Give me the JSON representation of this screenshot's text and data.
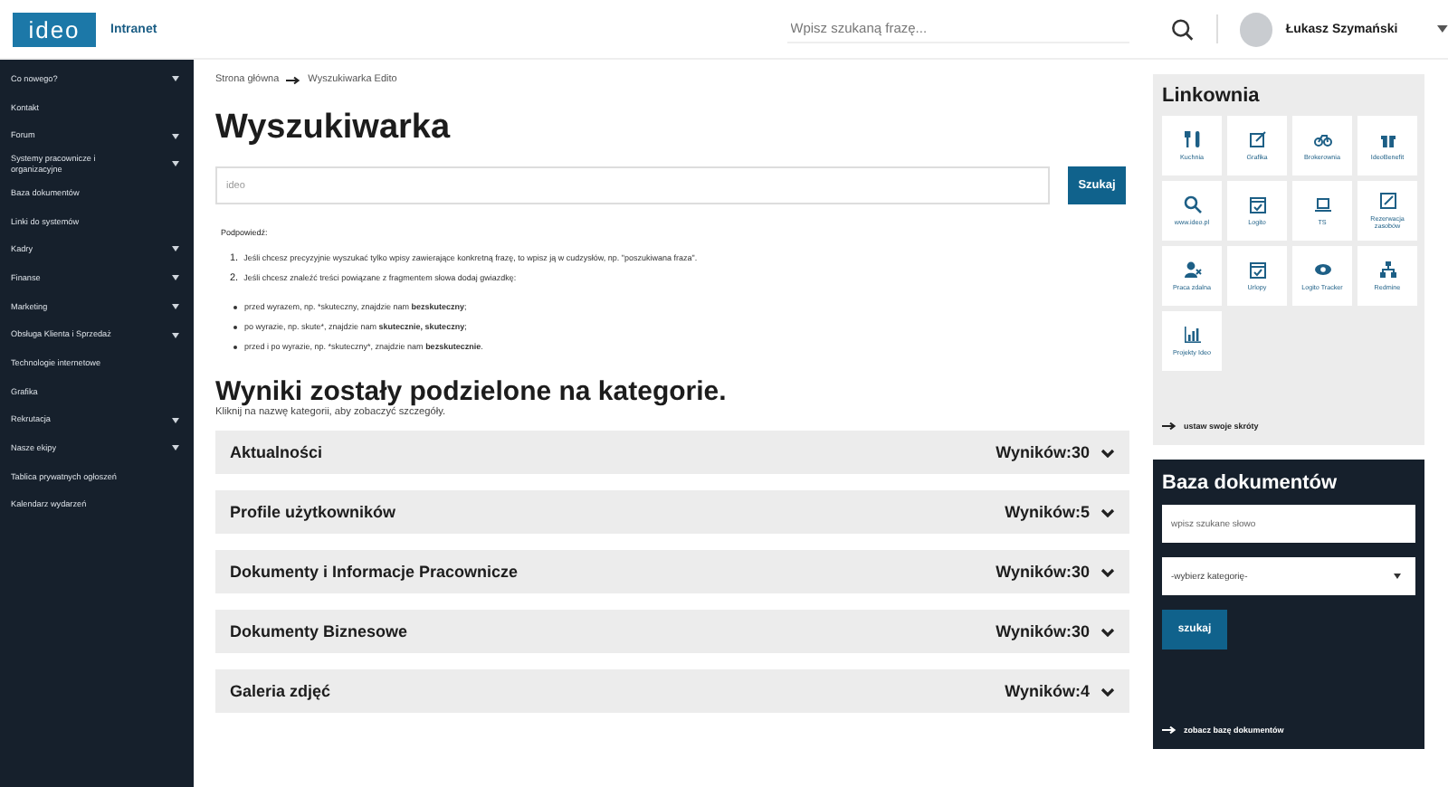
{
  "header": {
    "logo": "ideo",
    "app_name": "Intranet",
    "search": {
      "placeholder": "Wpisz szukaną frazę..."
    },
    "user": {
      "name": "Łukasz Szymański"
    }
  },
  "sidebar": {
    "items": [
      {
        "label": "Co nowego?",
        "expandable": true
      },
      {
        "label": "Kontakt",
        "expandable": false
      },
      {
        "label": "Forum",
        "expandable": true
      },
      {
        "label": "Systemy pracownicze i organizacyjne",
        "expandable": true
      },
      {
        "label": "Baza dokumentów",
        "expandable": false
      },
      {
        "label": "Linki do systemów",
        "expandable": false
      },
      {
        "label": "Kadry",
        "expandable": true
      },
      {
        "label": "Finanse",
        "expandable": true
      },
      {
        "label": "Marketing",
        "expandable": true
      },
      {
        "label": "Obsługa Klienta i Sprzedaż",
        "expandable": true
      },
      {
        "label": "Technologie internetowe",
        "expandable": false
      },
      {
        "label": "Grafika",
        "expandable": false
      },
      {
        "label": "Rekrutacja",
        "expandable": true
      },
      {
        "label": "Nasze ekipy",
        "expandable": true
      },
      {
        "label": "Tablica prywatnych ogłoszeń",
        "expandable": false
      },
      {
        "label": "Kalendarz wydarzeń",
        "expandable": false
      }
    ]
  },
  "breadcrumb": [
    "Strona główna",
    "Wyszukiwarka Edito"
  ],
  "title": "Wyszukiwarka",
  "search": {
    "value": "ideo",
    "button": "Szukaj"
  },
  "hints": {
    "heading": "Podpowiedź:",
    "numbered": [
      {
        "number": "1.",
        "text": "Jeśli chcesz precyzyjnie wyszukać tylko wpisy zawierające konkretną frazę, to wpisz ją w cudzysłów, np. \"poszukiwana fraza\"."
      },
      {
        "number": "2.",
        "text": "Jeśli chcesz znaleźć treści powiązane z fragmentem słowa dodaj gwiazdkę:"
      }
    ],
    "bullets": [
      {
        "text": "przed wyrazem, np. *skuteczny, znajdzie nam ",
        "bold": "bezskuteczny",
        "end": ";"
      },
      {
        "text": "po wyrazie, np. skute*, znajdzie nam ",
        "bold": "skutecznie, skuteczny",
        "end": ";"
      },
      {
        "text": "przed i po wyrazie, np. *skuteczny*, znajdzie nam ",
        "bold": "bezskutecznie",
        "end": "."
      }
    ]
  },
  "results": {
    "heading": "Wyniki zostały podzielone na kategorie.",
    "subheading": "Kliknij na nazwę kategorii, aby zobaczyć szczegóły.",
    "categories": [
      {
        "name": "Aktualności",
        "count": "Wyników:30",
        "expanded": false
      },
      {
        "name": "Profile użytkowników",
        "count": "Wyników:5",
        "expanded": false
      },
      {
        "name": "Dokumenty i Informacje Pracownicze",
        "count": "Wyników:30",
        "expanded": false
      },
      {
        "name": "Dokumenty Biznesowe",
        "count": "Wyników:30",
        "expanded": false
      },
      {
        "name": "Galeria zdjęć",
        "count": "Wyników:4",
        "expanded": false
      }
    ]
  },
  "linkownia": {
    "title": "Linkownia",
    "tiles": [
      "Kuchnia",
      "Grafika",
      "Brokerownia",
      "IdeoBenefit",
      "www.ideo.pl",
      "Logito",
      "TS",
      "Rezerwacja zasobów",
      "Praca zdalna",
      "Urlopy",
      "Logito Tracker",
      "Redmine",
      "Projekty Ideo"
    ],
    "footer_link": "ustaw swoje skróty"
  },
  "document_base": {
    "title": "Baza dokumentów",
    "search": {
      "placeholder": "wpisz szukane słowo"
    },
    "category": {
      "value": "-wybierz kategorię-"
    },
    "button": "szukaj",
    "footer_link": "zobacz bazę dokumentów"
  }
}
